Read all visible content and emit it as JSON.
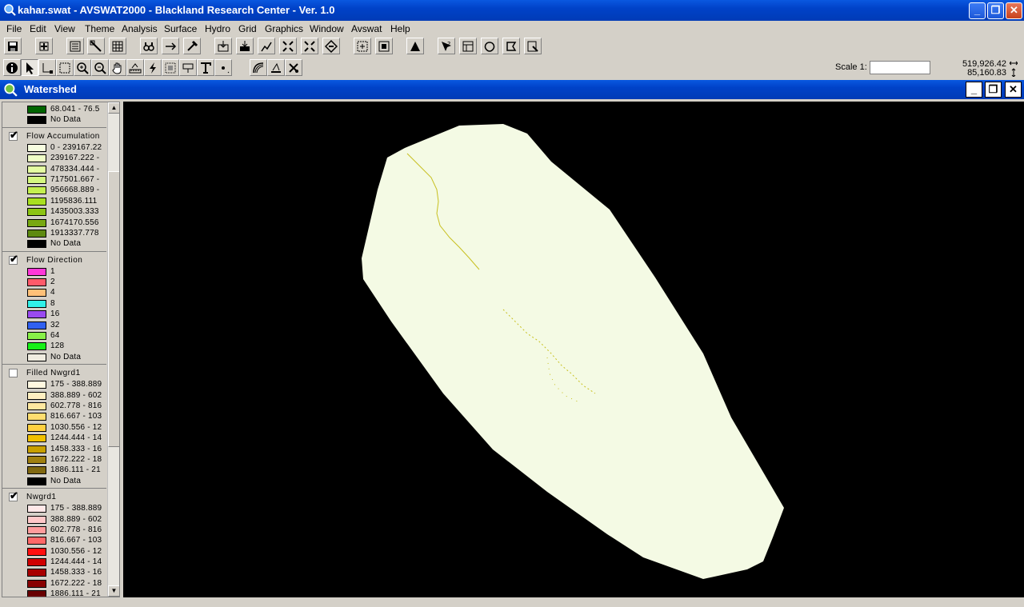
{
  "window": {
    "title": "kahar.swat - AVSWAT2000 - Blackland Research Center - Ver. 1.0"
  },
  "menu": [
    "File",
    "Edit",
    "View",
    "Theme",
    "Analysis",
    "Surface",
    "Hydro",
    "Grid",
    "Graphics",
    "Window",
    "Avswat",
    "Help"
  ],
  "scale": {
    "label": "Scale 1:",
    "value": ""
  },
  "coords": {
    "x": "519,926.42",
    "y": "85,160.83"
  },
  "view": {
    "title": "Watershed"
  },
  "legend": {
    "themes": [
      {
        "name": "",
        "checked": false,
        "partial": true,
        "classes": [
          {
            "label": "68.041 - 76.5",
            "color": "#006400"
          },
          {
            "label": "No Data",
            "color": "#000000"
          }
        ]
      },
      {
        "name": "Flow Accumulation",
        "checked": true,
        "classes": [
          {
            "label": "0 - 239167.22",
            "color": "#f7fde0"
          },
          {
            "label": "239167.222 -",
            "color": "#effdc6"
          },
          {
            "label": "478334.444 -",
            "color": "#e4fca2"
          },
          {
            "label": "717501.667 -",
            "color": "#d5f880"
          },
          {
            "label": "956668.889 -",
            "color": "#c4f050"
          },
          {
            "label": "1195836.111",
            "color": "#a9e020"
          },
          {
            "label": "1435003.333",
            "color": "#8cc414"
          },
          {
            "label": "1674170.556",
            "color": "#78a812"
          },
          {
            "label": "1913337.778",
            "color": "#5e8a10"
          },
          {
            "label": "No Data",
            "color": "#000000"
          }
        ]
      },
      {
        "name": "Flow Direction",
        "checked": true,
        "classes": [
          {
            "label": "1",
            "color": "#ff38d8"
          },
          {
            "label": "2",
            "color": "#ff5a6a"
          },
          {
            "label": "4",
            "color": "#ffc078"
          },
          {
            "label": "8",
            "color": "#30f0e8"
          },
          {
            "label": "16",
            "color": "#9a4af0"
          },
          {
            "label": "32",
            "color": "#3060f0"
          },
          {
            "label": "64",
            "color": "#88f048"
          },
          {
            "label": "128",
            "color": "#18f018"
          },
          {
            "label": "No Data",
            "color": "#f0ece0"
          }
        ]
      },
      {
        "name": "Filled Nwgrd1",
        "checked": false,
        "classes": [
          {
            "label": "175 - 388.889",
            "color": "#fff8e0"
          },
          {
            "label": "388.889 - 602",
            "color": "#ffefc0"
          },
          {
            "label": "602.778 - 816",
            "color": "#ffe8a0"
          },
          {
            "label": "816.667 - 103",
            "color": "#ffde70"
          },
          {
            "label": "1030.556 - 12",
            "color": "#ffd040"
          },
          {
            "label": "1244.444 - 14",
            "color": "#f0c000"
          },
          {
            "label": "1458.333 - 16",
            "color": "#c8a000"
          },
          {
            "label": "1672.222 - 18",
            "color": "#a08010"
          },
          {
            "label": "1886.111 - 21",
            "color": "#806810"
          },
          {
            "label": "No Data",
            "color": "#000000"
          }
        ]
      },
      {
        "name": "Nwgrd1",
        "checked": true,
        "classes": [
          {
            "label": "175 - 388.889",
            "color": "#ffe8e8"
          },
          {
            "label": "388.889 - 602",
            "color": "#ffc8c8"
          },
          {
            "label": "602.778 - 816",
            "color": "#ff9c9c"
          },
          {
            "label": "816.667 - 103",
            "color": "#ff6868"
          },
          {
            "label": "1030.556 - 12",
            "color": "#ff1010"
          },
          {
            "label": "1244.444 - 14",
            "color": "#d00000"
          },
          {
            "label": "1458.333 - 16",
            "color": "#a80000"
          },
          {
            "label": "1672.222 - 18",
            "color": "#880000"
          },
          {
            "label": "1886.111 - 21",
            "color": "#680000"
          }
        ]
      }
    ]
  },
  "colors": {
    "map_background": "#000000",
    "watershed_fill": "#f4fae4",
    "stream": "#c8c020"
  }
}
